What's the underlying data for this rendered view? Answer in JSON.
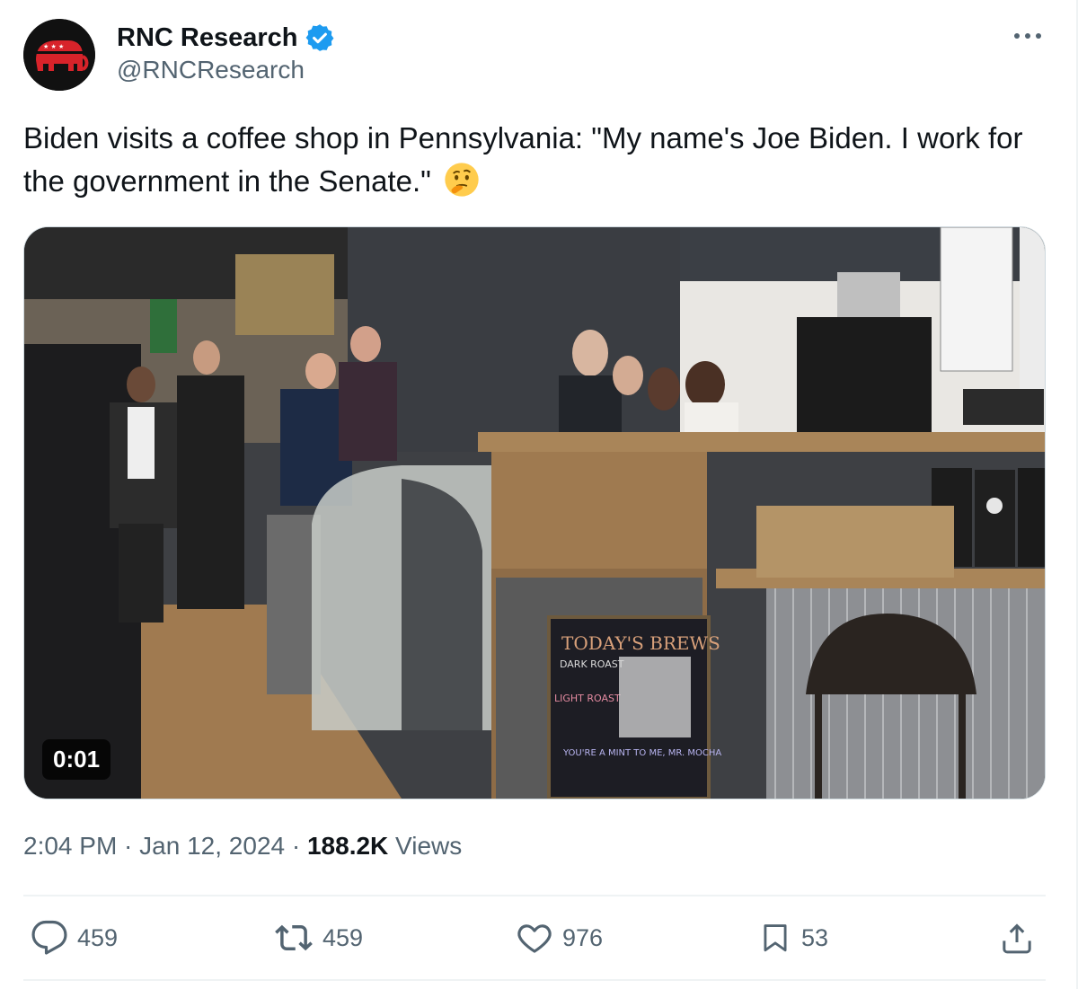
{
  "account": {
    "display_name": "RNC Research",
    "handle": "@RNCResearch",
    "verified": true,
    "avatar_icon": "republican-elephant-logo",
    "badge_color": "#1d9bf0",
    "avatar_color": "#d8232a"
  },
  "tweet": {
    "text": "Biden visits a coffee shop in Pennsylvania: \"My name's Joe Biden. I work for the government in the Senate.\"",
    "emoji": "thinking-face-emoji"
  },
  "media": {
    "duration": "0:01",
    "chalkboard": {
      "title": "TODAY'S BREWS",
      "line1": "DARK ROAST",
      "line2": "LIGHT ROAST",
      "line3": "YOU'RE A MINT TO ME, MR. MOCHA"
    }
  },
  "meta": {
    "time": "2:04 PM",
    "separator": " · ",
    "date": "Jan 12, 2024",
    "views_count": "188.2K",
    "views_label": " Views"
  },
  "actions": {
    "replies": "459",
    "reposts": "459",
    "likes": "976",
    "bookmarks": "53"
  },
  "icons": {
    "more": "more-horizontal-icon",
    "reply": "reply-icon",
    "repost": "repost-icon",
    "like": "heart-icon",
    "bookmark": "bookmark-icon",
    "share": "share-icon"
  }
}
